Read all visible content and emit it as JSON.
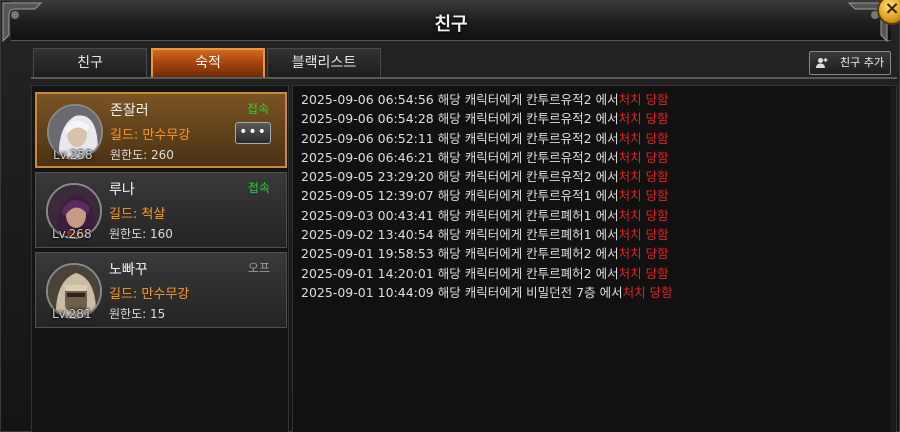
{
  "window": {
    "title": "친구",
    "close_label": "×"
  },
  "tabs": [
    {
      "label": "친구",
      "active": false
    },
    {
      "label": "숙적",
      "active": true
    },
    {
      "label": "블랙리스트",
      "active": false
    }
  ],
  "add_friend_label": "친구 추가",
  "enemies": [
    {
      "name": "존잘러",
      "level": "Lv.258",
      "guild": "길드: 만수무강",
      "grudge": "원한도: 260",
      "status": "접속",
      "online": true,
      "selected": true,
      "more_label": "•••"
    },
    {
      "name": "루나",
      "level": "Lv.268",
      "guild": "길드: 척살",
      "grudge": "원한도: 160",
      "status": "접속",
      "online": true,
      "selected": false
    },
    {
      "name": "노빠꾸",
      "level": "Lv.281",
      "guild": "길드: 만수무강",
      "grudge": "원한도: 15",
      "status": "오프",
      "online": false,
      "selected": false
    }
  ],
  "log": [
    {
      "time": "2025-09-06 06:54:56",
      "text": " 해당 캐릭터에게 칸투르유적2 에서",
      "kill": "처치 당함"
    },
    {
      "time": "2025-09-06 06:54:28",
      "text": " 해당 캐릭터에게 칸투르유적2 에서",
      "kill": "처치 당함"
    },
    {
      "time": "2025-09-06 06:52:11",
      "text": " 해당 캐릭터에게 칸투르유적2 에서",
      "kill": "처치 당함"
    },
    {
      "time": "2025-09-06 06:46:21",
      "text": " 해당 캐릭터에게 칸투르유적2 에서",
      "kill": "처치 당함"
    },
    {
      "time": "2025-09-05 23:29:20",
      "text": " 해당 캐릭터에게 칸투르유적2 에서",
      "kill": "처치 당함"
    },
    {
      "time": "2025-09-05 12:39:07",
      "text": " 해당 캐릭터에게 칸투르유적1 에서",
      "kill": "처치 당함"
    },
    {
      "time": "2025-09-03 00:43:41",
      "text": " 해당 캐릭터에게 칸투르폐허1 에서",
      "kill": "처치 당함"
    },
    {
      "time": "2025-09-02 13:40:54",
      "text": " 해당 캐릭터에게 칸투르폐허1 에서",
      "kill": "처치 당함"
    },
    {
      "time": "2025-09-01 19:58:53",
      "text": " 해당 캐릭터에게 칸투르폐허2 에서",
      "kill": "처치 당함"
    },
    {
      "time": "2025-09-01 14:20:01",
      "text": " 해당 캐릭터에게 칸투르폐허2 에서",
      "kill": "처치 당함"
    },
    {
      "time": "2025-09-01 10:44:09",
      "text": " 해당 캐릭터에게 비밀던전 7층 에서",
      "kill": "처치 당함"
    }
  ]
}
